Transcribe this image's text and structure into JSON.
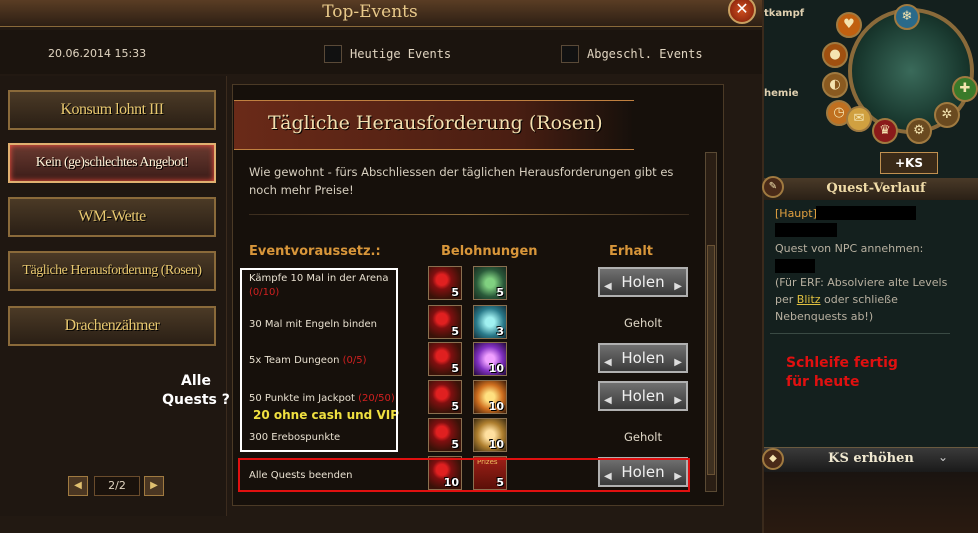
{
  "window": {
    "title": "Top-Events",
    "close_glyph": "✕",
    "datetime": "20.06.2014 15:33"
  },
  "filters": {
    "today_label": "Heutige Events",
    "completed_label": "Abgeschl. Events"
  },
  "menu": {
    "items": [
      {
        "label": "Konsum lohnt III",
        "active": false
      },
      {
        "label": "Kein (ge)schlechtes Angebot!",
        "active": true
      },
      {
        "label": "WM-Wette",
        "active": false
      },
      {
        "label": "Tägliche Herausforderung (Rosen)",
        "active": false
      },
      {
        "label": "Drachenzähmer",
        "active": false
      }
    ],
    "pager": {
      "text": "2/2",
      "prev_glyph": "◀",
      "next_glyph": "▶"
    }
  },
  "event": {
    "title": "Tägliche Herausforderung (Rosen)",
    "description": "Wie gewohnt - fürs Abschliessen der täglichen Herausforderungen gibt es noch mehr Preise!",
    "columns": {
      "requirements": "Eventvoraussetz.:",
      "rewards": "Belohnungen",
      "received": "Erhalt"
    },
    "rows": [
      {
        "requirement": "Kämpfe 10 Mal in der Arena",
        "progress": "(0/10)",
        "reward1_icon": "rose-icon",
        "reward1_qty": "5",
        "reward2_icon": "green-gem-icon",
        "reward2_qty": "5",
        "status": "Holen",
        "claimable": true
      },
      {
        "requirement": "30 Mal mit Engeln binden",
        "progress": "",
        "reward1_icon": "rose-icon",
        "reward1_qty": "5",
        "reward2_icon": "cyan-potion-icon",
        "reward2_qty": "3",
        "status": "Geholt",
        "claimable": false
      },
      {
        "requirement": "5x Team Dungeon",
        "progress": "(0/5)",
        "reward1_icon": "rose-icon",
        "reward1_qty": "5",
        "reward2_icon": "purple-orb-icon",
        "reward2_qty": "10",
        "status": "Holen",
        "claimable": true
      },
      {
        "requirement": "50 Punkte im Jackpot",
        "progress": "(20/50)",
        "reward1_icon": "rose-icon",
        "reward1_qty": "5",
        "reward2_icon": "orange-orb-icon",
        "reward2_qty": "10",
        "status": "Holen",
        "claimable": true
      },
      {
        "requirement": "300 Erebospunkte",
        "progress": "",
        "reward1_icon": "rose-icon",
        "reward1_qty": "5",
        "reward2_icon": "gold-crest-icon",
        "reward2_qty": "10",
        "status": "Geholt",
        "claimable": false
      },
      {
        "requirement": "Alle Quests beenden",
        "progress": "",
        "reward1_icon": "rose-icon",
        "reward1_qty": "10",
        "reward2_icon": "prize-box-icon",
        "reward2_qty": "5",
        "reward2_label": "Prizes",
        "status": "Holen",
        "claimable": true
      }
    ]
  },
  "annotations": {
    "left_question": "Alle Quests ?",
    "yellow_note": "20 ohne cash und VIP",
    "right_note_line1": "Schleife fertig",
    "right_note_line2": "für heute"
  },
  "sidepanel": {
    "ks_button": "+KS",
    "quest_panel_title": "Quest-Verlauf",
    "quest_tag": "[Haupt]",
    "quest_line": "Quest von NPC annehmen:",
    "hint_before": "(Für ERF: Absolviere alte Levels per ",
    "hint_link": "Blitz",
    "hint_after": " oder schließe Nebenquests ab!)",
    "ks_panel_title": "KS erhöhen",
    "partial_labels": {
      "kampf": "tkampf",
      "mie": "hemie"
    }
  },
  "colors": {
    "accent_gold": "#e8c870",
    "progress_red": "#d02020",
    "annotation_red": "#e01010",
    "annotation_yellow": "#f0e040"
  }
}
